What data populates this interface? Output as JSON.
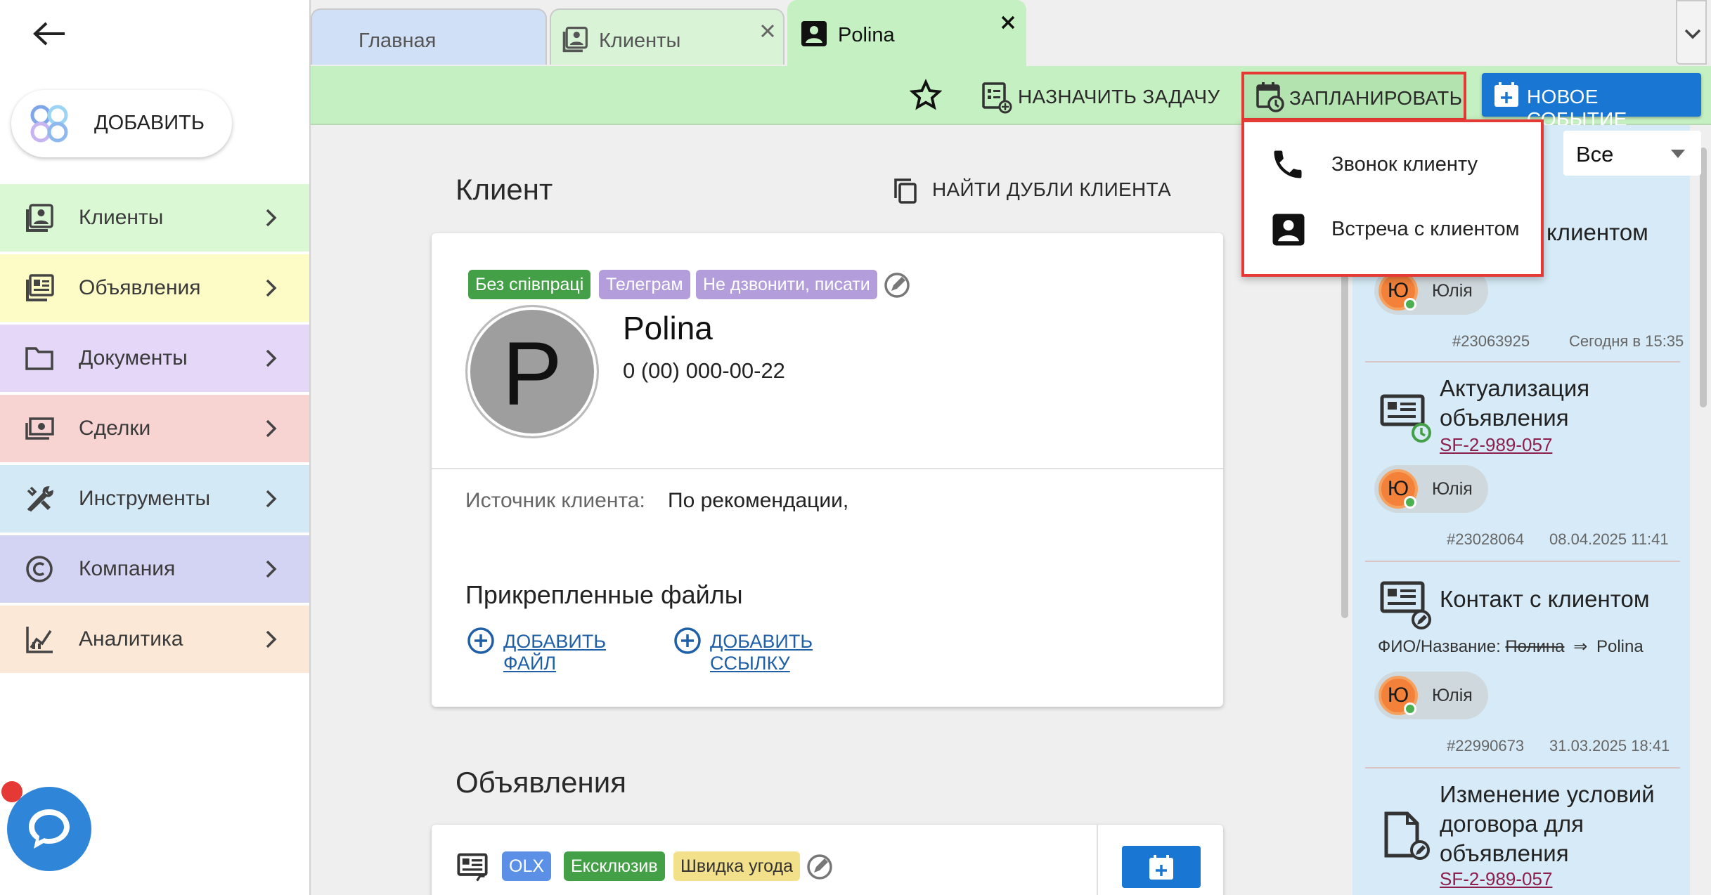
{
  "sidebar": {
    "add_label": "ДОБАВИТЬ",
    "items": [
      {
        "label": "Клиенты",
        "icon": "contacts-icon",
        "color": "#d9f8d3"
      },
      {
        "label": "Объявления",
        "icon": "listing-icon",
        "color": "#fdfcc6"
      },
      {
        "label": "Документы",
        "icon": "folder-icon",
        "color": "#e4d7f7"
      },
      {
        "label": "Сделки",
        "icon": "money-icon",
        "color": "#f7d4d2"
      },
      {
        "label": "Инструменты",
        "icon": "tools-icon",
        "color": "#d4e9f6"
      },
      {
        "label": "Компания",
        "icon": "copyright-icon",
        "color": "#d3d3f3"
      },
      {
        "label": "Аналитика",
        "icon": "analytics-icon",
        "color": "#fbe8d6"
      }
    ]
  },
  "tabs": [
    {
      "label": "Главная"
    },
    {
      "label": "Клиенты"
    },
    {
      "label": "Polina"
    }
  ],
  "toolbar": {
    "assign_task": "НАЗНАЧИТЬ ЗАДАЧУ",
    "schedule": "ЗАПЛАНИРОВАТЬ",
    "new_event": "НОВОЕ СОБЫТИЕ"
  },
  "schedule_menu": {
    "items": [
      "Звонок клиенту",
      "Встреча с клиентом"
    ]
  },
  "client": {
    "section_title": "Клиент",
    "find_duplicates": "НАЙТИ ДУБЛИ КЛИЕНТА",
    "tags": [
      {
        "label": "Без співпраці",
        "color": "#43a047"
      },
      {
        "label": "Телеграм",
        "color": "#b39ddb"
      },
      {
        "label": "Не дзвонити, писати",
        "color": "#b39ddb"
      }
    ],
    "avatar_letter": "P",
    "name": "Polina",
    "phone": "0 (00) 000-00-22",
    "source_label": "Источник клиента:",
    "source_value": "По рекомендации,",
    "files_title": "Прикрепленные файлы",
    "add_file": "ДОБАВИТЬ ФАЙЛ",
    "add_link": "ДОБАВИТЬ ССЫЛКУ"
  },
  "listings": {
    "section_title": "Объявления",
    "tags": [
      {
        "label": "OLX",
        "color": "#5c8fe6"
      },
      {
        "label": "Ексклюзив",
        "color": "#43a047"
      },
      {
        "label": "Швидка угода",
        "color": "#f3e08a"
      }
    ]
  },
  "feed": {
    "filter_value": "Все",
    "partial_title": "клиентом",
    "items": [
      {
        "user_initial": "Ю",
        "user_name": "Юлія",
        "id": "#23063925",
        "time": "Сегодня в 15:35"
      },
      {
        "title_line1": "Актуализация",
        "title_line2": "объявления",
        "link": "SF-2-989-057",
        "user_initial": "Ю",
        "user_name": "Юлія",
        "id": "#23028064",
        "time": "08.04.2025 11:41"
      },
      {
        "title": "Контакт с клиентом",
        "change_label": "ФИО/Название:",
        "old_value": "Полина",
        "arrow": "⇒",
        "new_value": "Polina",
        "user_initial": "Ю",
        "user_name": "Юлія",
        "id": "#22990673",
        "time": "31.03.2025 18:41"
      },
      {
        "title_line1": "Изменение условий",
        "title_line2": "договора для",
        "title_line3": "объявления",
        "link": "SF-2-989-057"
      }
    ]
  },
  "colors": {
    "toolbar_bg": "#c5f0c1",
    "active_tab_bg": "#c5f0c1",
    "primary": "#1976d2",
    "highlight_border": "#e53935",
    "feed_bg": "#d6ebf7"
  }
}
